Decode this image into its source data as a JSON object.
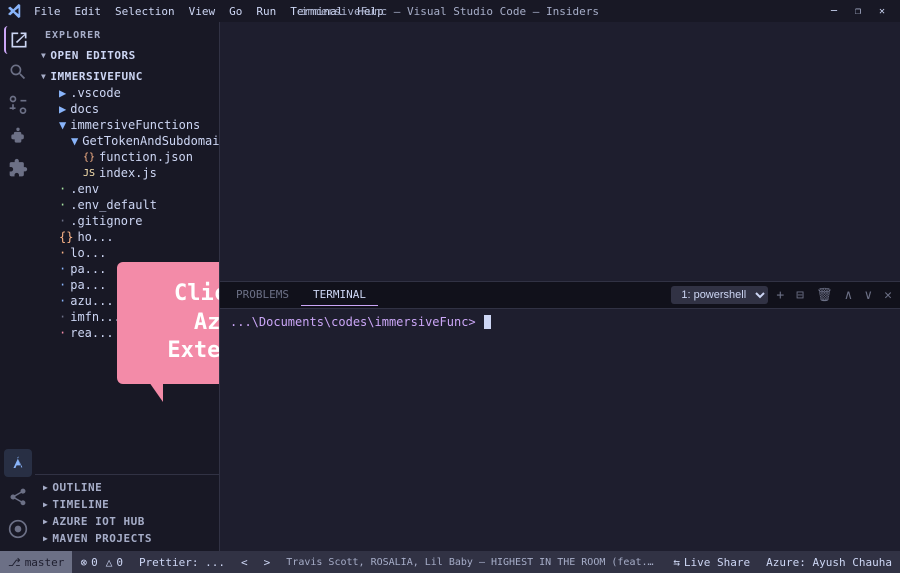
{
  "titlebar": {
    "title": "immersiveFunc – Visual Studio Code – Insiders",
    "menu": [
      "File",
      "Edit",
      "Selection",
      "View",
      "Go",
      "Run",
      "Terminal",
      "Help"
    ],
    "controls": [
      "—",
      "❐",
      "✕"
    ]
  },
  "activity": {
    "icons": [
      {
        "name": "explorer-icon",
        "symbol": "⎘",
        "active": true
      },
      {
        "name": "search-icon",
        "symbol": "🔍",
        "active": false
      },
      {
        "name": "source-control-icon",
        "symbol": "⎇",
        "active": false
      },
      {
        "name": "debug-icon",
        "symbol": "▷",
        "active": false
      },
      {
        "name": "extensions-icon",
        "symbol": "⊞",
        "active": false
      },
      {
        "name": "azure-icon",
        "symbol": "☁",
        "active": false
      },
      {
        "name": "live-share-icon",
        "symbol": "⇆",
        "active": false
      },
      {
        "name": "remote-icon",
        "symbol": "⊙",
        "active": false
      }
    ]
  },
  "sidebar": {
    "title": "EXPLORER",
    "sections": {
      "open_editors": "OPEN EDITORS",
      "immersivefunc": "IMMERSIVEFUNC"
    },
    "tree": [
      {
        "label": ".vscode",
        "type": "folder",
        "indent": 1,
        "color": "blue"
      },
      {
        "label": "docs",
        "type": "folder",
        "indent": 1,
        "color": "blue"
      },
      {
        "label": "immersiveFunctions",
        "type": "folder",
        "indent": 1,
        "color": "blue"
      },
      {
        "label": "GetTokenAndSubdomain",
        "type": "folder",
        "indent": 2,
        "color": "blue"
      },
      {
        "label": "function.json",
        "type": "file",
        "indent": 3,
        "color": "yellow"
      },
      {
        "label": "index.js",
        "type": "file",
        "indent": 3,
        "color": "yellow"
      },
      {
        "label": ".env",
        "type": "file",
        "indent": 1,
        "color": "green"
      },
      {
        "label": ".env_default",
        "type": "file",
        "indent": 1,
        "color": "green"
      },
      {
        "label": ".gitignore",
        "type": "file",
        "indent": 1,
        "color": "gray"
      },
      {
        "label": "ho...",
        "type": "file",
        "indent": 1,
        "color": "orange"
      },
      {
        "label": "lo...",
        "type": "file",
        "indent": 1,
        "color": "orange"
      },
      {
        "label": "pa...",
        "type": "file",
        "indent": 1,
        "color": "blue"
      },
      {
        "label": "pa...",
        "type": "file",
        "indent": 1,
        "color": "blue"
      },
      {
        "label": "azu...",
        "type": "file",
        "indent": 1,
        "color": "blue"
      },
      {
        "label": "imfn...",
        "type": "file",
        "indent": 1,
        "color": "gray"
      },
      {
        "label": "rea... und",
        "type": "file",
        "indent": 1,
        "color": "red"
      }
    ],
    "bottom": [
      {
        "label": "OUTLINE"
      },
      {
        "label": "TIMELINE"
      },
      {
        "label": "AZURE IOT HUB"
      },
      {
        "label": "MAVEN PROJECTS"
      }
    ]
  },
  "tooltip": {
    "text": "Click on Azure Extension"
  },
  "terminal": {
    "tabs": [
      "PROBLEMS",
      "TERMINAL"
    ],
    "active_tab": "TERMINAL",
    "dropdown": "1: powershell",
    "prompt_path": "...\\Documents\\codes\\immersiveFunc>",
    "toolbar_buttons": [
      "+",
      "⊟",
      "🗑",
      "∧",
      "∨",
      "✕"
    ]
  },
  "statusbar": {
    "git": "⎇ master",
    "errors": "⊗ 0  △ 0",
    "formatter": "Prettier: ...",
    "arrows_left": "＜",
    "arrows_right": "＞",
    "music": "Travis Scott, ROSALÍA, Lil Baby – HIGHEST IN THE ROOM (feat. ROSALÍA & Lil Baby)",
    "live_share": "⇆ Live Share",
    "azure": "Azure: Ayush Chauha",
    "remote": "⊙"
  }
}
